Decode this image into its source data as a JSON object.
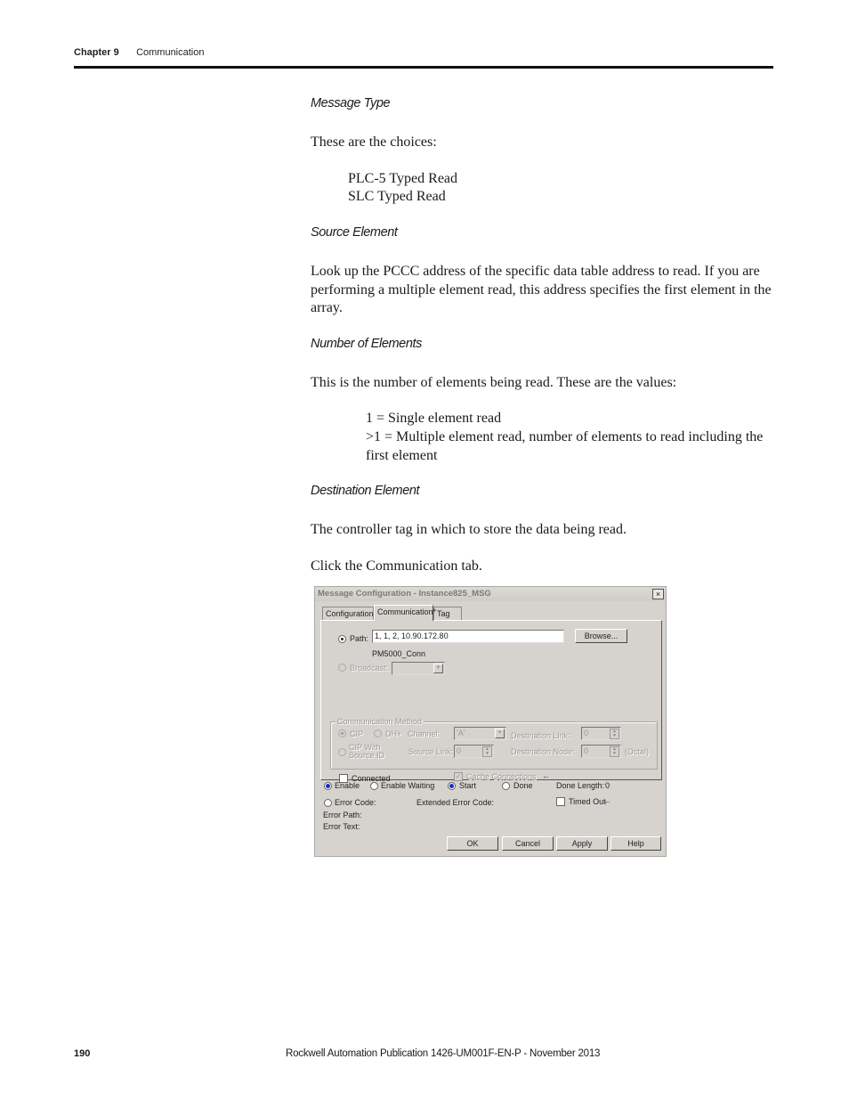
{
  "header": {
    "chapter": "Chapter 9",
    "section": "Communication"
  },
  "content": {
    "message_type": {
      "heading": "Message Type",
      "intro": "These are the choices:",
      "choices": [
        "PLC-5 Typed Read",
        "SLC Typed Read"
      ]
    },
    "source_element": {
      "heading": "Source Element",
      "body": "Look up the PCCC address of the specific data table address to read. If you are performing a multiple element read, this address specifies the first element in the array."
    },
    "number_of_elements": {
      "heading": "Number of Elements",
      "intro": "This is the number of elements being read. These are the values:",
      "values": [
        "1 = Single element read",
        ">1 = Multiple element read, number of elements to read including the first element"
      ]
    },
    "destination_element": {
      "heading": "Destination Element",
      "body": "The controller tag in which to store the data being read."
    },
    "instruction": "Click the Communication tab."
  },
  "dialog": {
    "title": "Message Configuration - Instance825_MSG",
    "close_label": "×",
    "tabs": [
      {
        "label": "Configuration*",
        "active": false
      },
      {
        "label": "Communication*",
        "active": true
      },
      {
        "label": "Tag",
        "active": false
      }
    ],
    "path_label": "Path:",
    "path_value": "1, 1, 2, 10.90.172.80",
    "path_name": "PM5000_Conn",
    "browse_label": "Browse...",
    "broadcast_label": "Broadcast:",
    "broadcast_value": "",
    "comm_method": {
      "title": "Communication Method",
      "cip_label": "CIP",
      "dh_label": "DH+",
      "channel_label": "Channel:",
      "channel_value": "'A'",
      "dest_link_label": "Destination Link:",
      "dest_link_value": "0",
      "cip_source_label_1": "CIP With",
      "cip_source_label_2": "Source ID",
      "source_link_label": "Source Link:",
      "source_link_value": "0",
      "dest_node_label": "Destination Node:",
      "dest_node_value": "0",
      "octal_label": "(Octal)"
    },
    "connected_label": "Connected",
    "connected_checked": false,
    "cache_label": "Cache Connections",
    "cache_checked": true,
    "status": {
      "enable": "Enable",
      "enable_waiting": "Enable Waiting",
      "start": "Start",
      "done": "Done",
      "done_length_label": "Done Length:",
      "done_length_value": "0",
      "error_code": "Error Code:",
      "extended_error_code": "Extended Error Code:",
      "timed_out": "Timed Out",
      "error_path": "Error Path:",
      "error_text": "Error Text:"
    },
    "buttons": {
      "ok": "OK",
      "cancel": "Cancel",
      "apply": "Apply",
      "help": "Help"
    }
  },
  "footer": {
    "page_number": "190",
    "publication": "Rockwell Automation Publication 1426-UM001F-EN-P - November 2013"
  }
}
